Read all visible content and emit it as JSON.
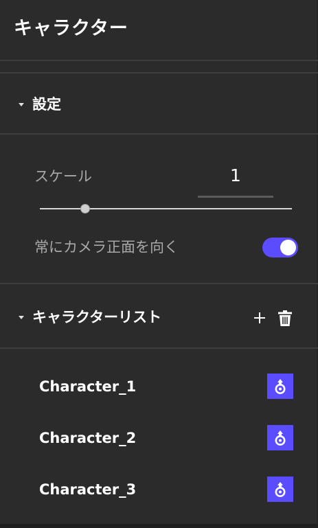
{
  "header": {
    "title": "キャラクター"
  },
  "settings": {
    "section_title": "設定",
    "scale_label": "スケール",
    "scale_value": "1",
    "scale_slider_fraction": 0.18,
    "face_camera_label": "常にカメラ正面を向く",
    "face_camera_enabled": true
  },
  "character_list": {
    "section_title": "キャラクターリスト",
    "items": [
      {
        "name": "Character_1",
        "action_icon": "pin-location-icon"
      },
      {
        "name": "Character_2",
        "action_icon": "pin-location-icon"
      },
      {
        "name": "Character_3",
        "action_icon": "pin-location-icon"
      }
    ]
  },
  "colors": {
    "accent": "#5b4cff",
    "panel_bg": "#2b2b2b",
    "divider": "#3e3e3e",
    "text_primary": "#ffffff",
    "text_secondary": "#a8a8a8"
  },
  "icons": {
    "add": "plus-icon",
    "delete": "trash-icon",
    "collapse": "caret-down-icon"
  }
}
